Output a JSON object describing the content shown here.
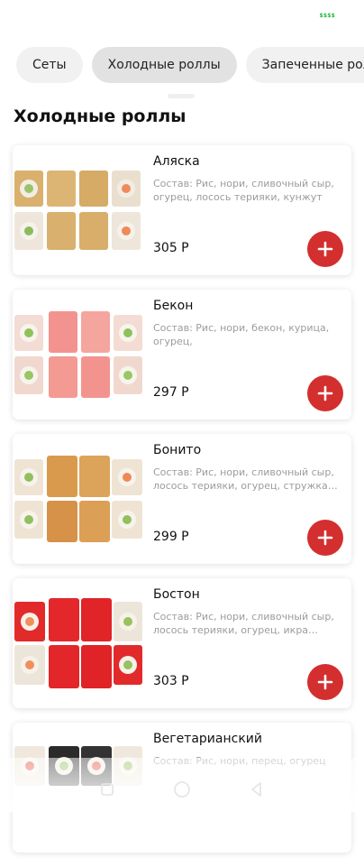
{
  "status_bar": {
    "badge": "$$$$"
  },
  "tabs": [
    {
      "label": "Сеты",
      "active": false
    },
    {
      "label": "Холодные роллы",
      "active": true
    },
    {
      "label": "Запеченные роллы",
      "active": false
    }
  ],
  "section_title": "Холодные роллы",
  "products": [
    {
      "name": "Аляска",
      "description": "Состав: Рис, нори, сливочный сыр, огурец, лосось терияки, кунжут",
      "price": "305 Р",
      "image_icon": "sushi-roll-sesame-icon"
    },
    {
      "name": "Бекон",
      "description": "Состав: Рис, нори, бекон, курица, огурец,",
      "price": "297 Р",
      "image_icon": "sushi-roll-bacon-icon"
    },
    {
      "name": "Бонито",
      "description": "Состав: Рис, нори, сливочный сыр, лосось терияки, огурец, стружка тунца",
      "price": "299 Р",
      "image_icon": "sushi-roll-bonito-icon"
    },
    {
      "name": "Бостон",
      "description": "Состав: Рис, нори, сливочный сыр, лосось терияки, огурец, икра масаго",
      "price": "303 Р",
      "image_icon": "sushi-roll-tobiko-icon"
    },
    {
      "name": "Вегетарианский",
      "description": "Состав: Рис, нори, перец, огурец",
      "price": "",
      "image_icon": "sushi-roll-veggie-icon"
    }
  ],
  "colors": {
    "accent": "#d32f2f",
    "status_badge": "#29b84a",
    "tab_active_bg": "#e2e2e2",
    "tab_bg": "#f1f1f1"
  },
  "bottom_nav": {
    "icons": [
      "nav-square-icon",
      "nav-circle-icon",
      "nav-triangle-icon"
    ]
  }
}
